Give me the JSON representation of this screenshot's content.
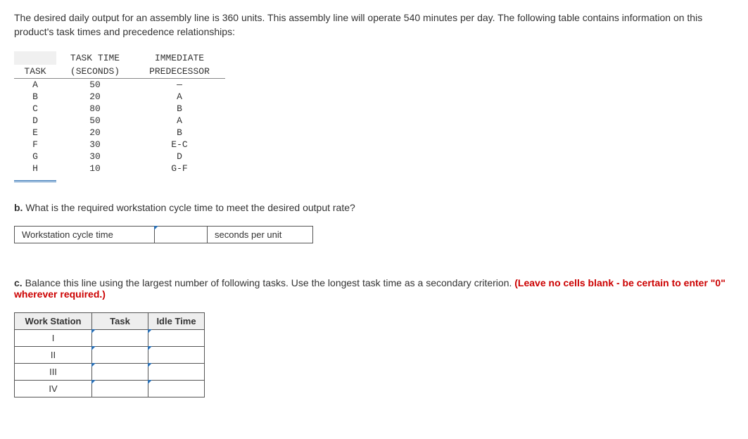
{
  "intro": "The desired daily output for an assembly line is 360 units. This assembly line will operate 540 minutes per day. The following table contains information on this product's task times and precedence relationships:",
  "table": {
    "header_time_line1": "TASK TIME",
    "header_task": "TASK",
    "header_time_line2": "(SECONDS)",
    "header_pred_line1": "IMMEDIATE",
    "header_pred_line2": "PREDECESSOR",
    "rows": [
      {
        "task": "A",
        "time": "50",
        "pred": "—"
      },
      {
        "task": "B",
        "time": "20",
        "pred": "A"
      },
      {
        "task": "C",
        "time": "80",
        "pred": "B"
      },
      {
        "task": "D",
        "time": "50",
        "pred": "A"
      },
      {
        "task": "E",
        "time": "20",
        "pred": "B"
      },
      {
        "task": "F",
        "time": "30",
        "pred": "E-C"
      },
      {
        "task": "G",
        "time": "30",
        "pred": "D"
      },
      {
        "task": "H",
        "time": "10",
        "pred": "G-F"
      }
    ]
  },
  "partB": {
    "prefix": "b.",
    "text": " What is the required workstation cycle time to meet the desired output rate?",
    "label": "Workstation cycle time",
    "value": "",
    "unit": "seconds per unit"
  },
  "partC": {
    "prefix": "c.",
    "text": " Balance this line using the largest number of following tasks. Use the longest task time as a secondary criterion. ",
    "hint": "(Leave no cells blank - be certain to enter \"0\" wherever required.)",
    "headers": {
      "ws": "Work Station",
      "task": "Task",
      "idle": "Idle Time"
    },
    "rows": [
      {
        "ws": "I",
        "task": "",
        "idle": ""
      },
      {
        "ws": "II",
        "task": "",
        "idle": ""
      },
      {
        "ws": "III",
        "task": "",
        "idle": ""
      },
      {
        "ws": "IV",
        "task": "",
        "idle": ""
      }
    ]
  }
}
